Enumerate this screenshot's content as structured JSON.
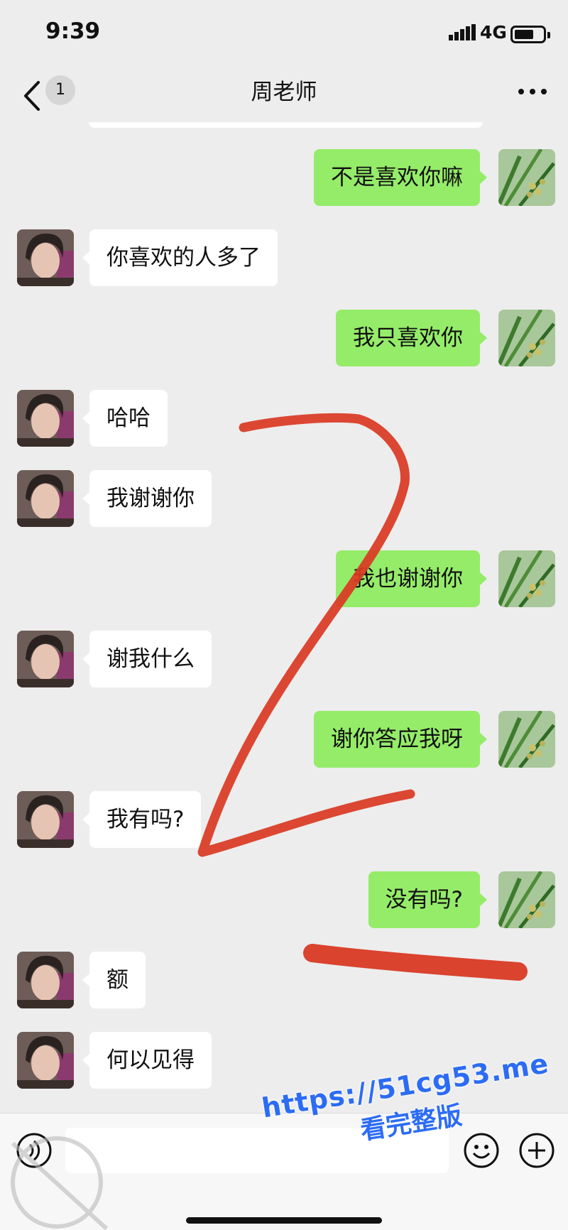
{
  "status_bar": {
    "time": "9:39",
    "network": "4G"
  },
  "header": {
    "back_badge": "1",
    "title": "周老师"
  },
  "messages": [
    {
      "side": "right",
      "text": "不是喜欢你嘛"
    },
    {
      "side": "left",
      "text": "你喜欢的人多了"
    },
    {
      "side": "right",
      "text": "我只喜欢你"
    },
    {
      "side": "left",
      "text": "哈哈"
    },
    {
      "side": "left",
      "text": "我谢谢你"
    },
    {
      "side": "right",
      "text": "我也谢谢你"
    },
    {
      "side": "left",
      "text": "谢我什么"
    },
    {
      "side": "right",
      "text": "谢你答应我呀"
    },
    {
      "side": "left",
      "text": "我有吗?"
    },
    {
      "side": "right",
      "text": "没有吗?"
    },
    {
      "side": "left",
      "text": "额"
    },
    {
      "side": "left",
      "text": "何以见得"
    }
  ],
  "watermark": {
    "url": "https://51cg53.me",
    "subtitle": "看完整版"
  },
  "colors": {
    "outgoing_bubble": "#95ec69",
    "incoming_bubble": "#ffffff",
    "background": "#ededed",
    "annotation": "#d93a24",
    "watermark": "#2c6cf4"
  },
  "icons": {
    "back": "chevron-left-icon",
    "more": "more-dots-icon",
    "voice": "voice-icon",
    "emoji": "emoji-icon",
    "plus": "plus-icon"
  }
}
